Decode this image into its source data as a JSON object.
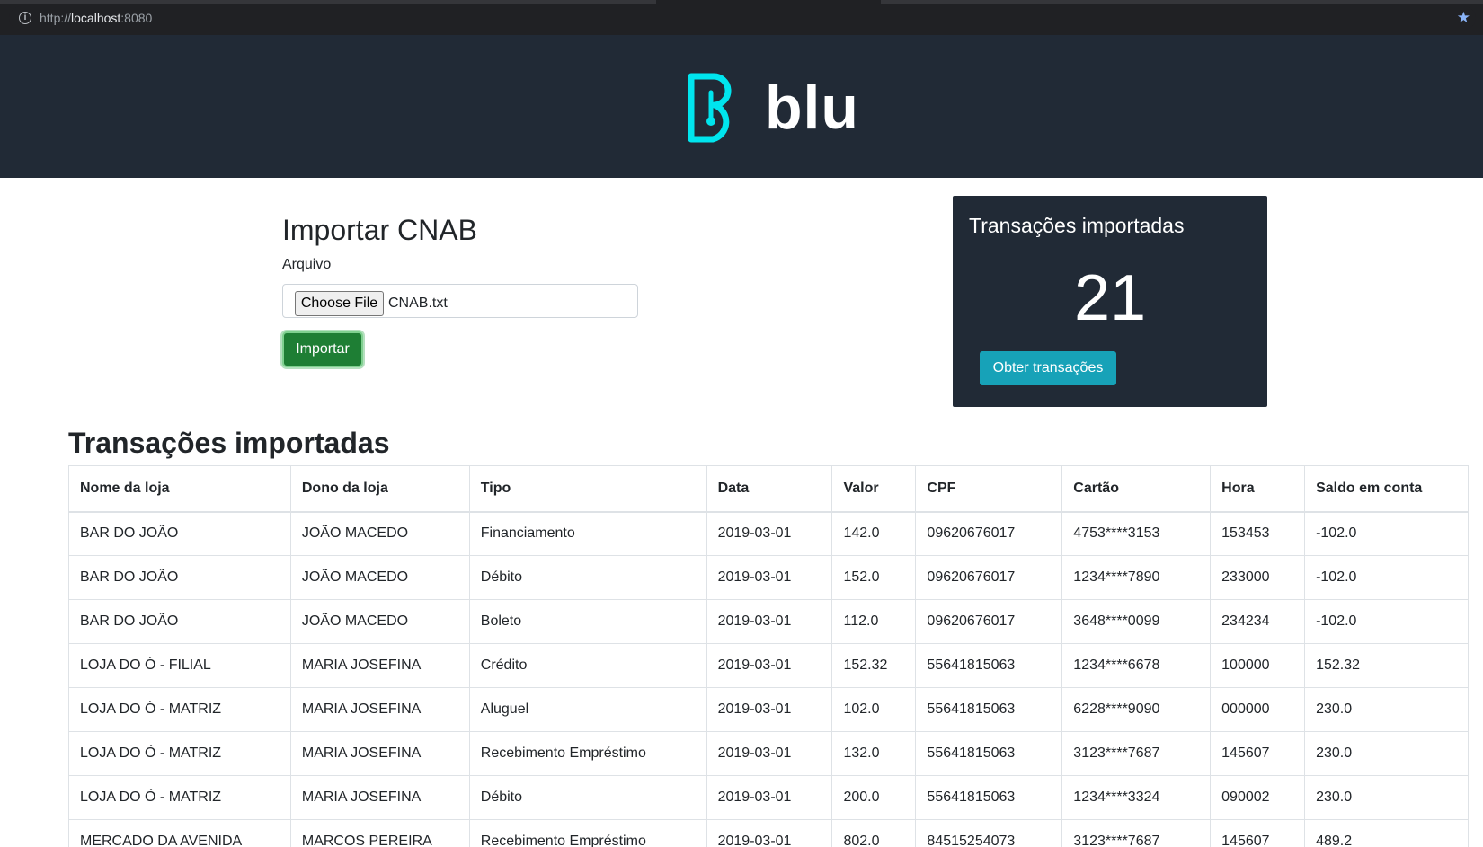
{
  "browser": {
    "url_scheme": "http://",
    "url_host": "localhost",
    "url_port": ":8080"
  },
  "header": {
    "logo_text": "blu",
    "logo_color": "#00e5ee",
    "background": "#212a36"
  },
  "import_form": {
    "title": "Importar CNAB",
    "file_label": "Arquivo",
    "choose_file_label": "Choose File",
    "file_name": "CNAB.txt",
    "submit_label": "Importar"
  },
  "summary": {
    "title": "Transações importadas",
    "count": "21",
    "button_label": "Obter transações"
  },
  "table": {
    "title": "Transações importadas",
    "columns": [
      "Nome da loja",
      "Dono da loja",
      "Tipo",
      "Data",
      "Valor",
      "CPF",
      "Cartão",
      "Hora",
      "Saldo em conta"
    ],
    "rows": [
      [
        "BAR DO JOÃO",
        "JOÃO MACEDO",
        "Financiamento",
        "2019-03-01",
        "142.0",
        "09620676017",
        "4753****3153",
        "153453",
        "-102.0"
      ],
      [
        "BAR DO JOÃO",
        "JOÃO MACEDO",
        "Débito",
        "2019-03-01",
        "152.0",
        "09620676017",
        "1234****7890",
        "233000",
        "-102.0"
      ],
      [
        "BAR DO JOÃO",
        "JOÃO MACEDO",
        "Boleto",
        "2019-03-01",
        "112.0",
        "09620676017",
        "3648****0099",
        "234234",
        "-102.0"
      ],
      [
        "LOJA DO Ó - FILIAL",
        "MARIA JOSEFINA",
        "Crédito",
        "2019-03-01",
        "152.32",
        "55641815063",
        "1234****6678",
        "100000",
        "152.32"
      ],
      [
        "LOJA DO Ó - MATRIZ",
        "MARIA JOSEFINA",
        "Aluguel",
        "2019-03-01",
        "102.0",
        "55641815063",
        "6228****9090",
        "000000",
        "230.0"
      ],
      [
        "LOJA DO Ó - MATRIZ",
        "MARIA JOSEFINA",
        "Recebimento Empréstimo",
        "2019-03-01",
        "132.0",
        "55641815063",
        "3123****7687",
        "145607",
        "230.0"
      ],
      [
        "LOJA DO Ó - MATRIZ",
        "MARIA JOSEFINA",
        "Débito",
        "2019-03-01",
        "200.0",
        "55641815063",
        "1234****3324",
        "090002",
        "230.0"
      ],
      [
        "MERCADO DA AVENIDA",
        "MARCOS PEREIRA",
        "Recebimento Empréstimo",
        "2019-03-01",
        "802.0",
        "84515254073",
        "3123****7687",
        "145607",
        "489.2"
      ]
    ]
  }
}
